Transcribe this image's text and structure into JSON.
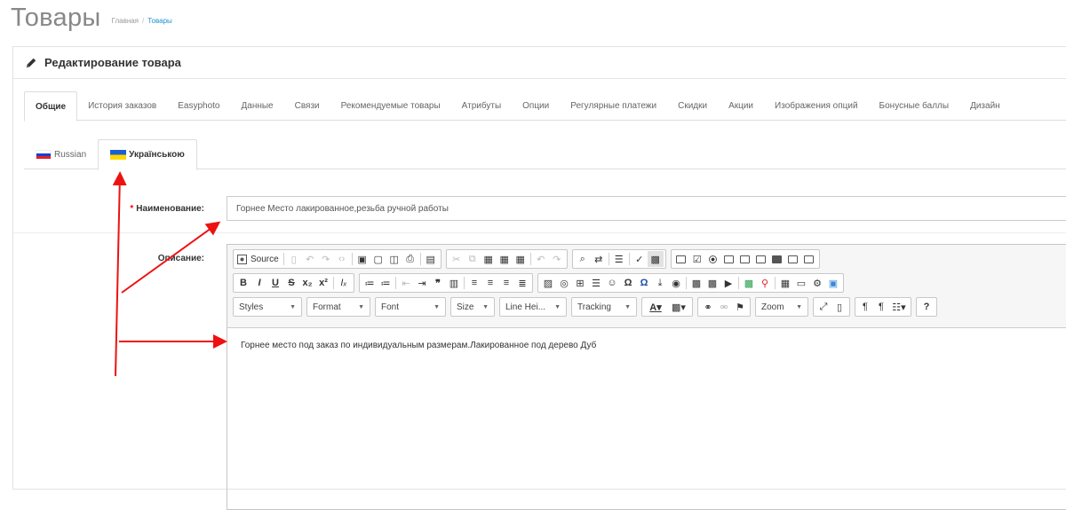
{
  "page": {
    "title": "Товары",
    "breadcrumb": {
      "home": "Главная",
      "separator": "/",
      "current": "Товары"
    }
  },
  "panel": {
    "title": "Редактирование товара",
    "icon": "pencil-icon"
  },
  "tabs": [
    {
      "label": "Общие",
      "active": true
    },
    {
      "label": "История заказов"
    },
    {
      "label": "Easyphoto"
    },
    {
      "label": "Данные"
    },
    {
      "label": "Связи"
    },
    {
      "label": "Рекомендуемые товары"
    },
    {
      "label": "Атрибуты"
    },
    {
      "label": "Опции"
    },
    {
      "label": "Регулярные платежи"
    },
    {
      "label": "Скидки"
    },
    {
      "label": "Акции"
    },
    {
      "label": "Изображения опций"
    },
    {
      "label": "Бонусные баллы"
    },
    {
      "label": "Дизайн"
    }
  ],
  "languages": [
    {
      "label": "Russian",
      "flag": "flag-ru"
    },
    {
      "label": "Українською",
      "flag": "flag-ua",
      "active": true
    }
  ],
  "form": {
    "name_required_mark": "*",
    "name_label": "Наименование:",
    "name_value": "Горнее Место лакированное,резьба ручной работы",
    "description_label": "Описание:"
  },
  "editor": {
    "source_label": "Source",
    "combos": [
      "Styles",
      "Format",
      "Font",
      "Size",
      "Line Hei...",
      "Tracking",
      "Zoom"
    ],
    "content": "Горнее место под заказ по индивидуальным размерам.Лакированное под дерево Дуб",
    "help_label": "?"
  },
  "colors": {
    "accent": "#1e91cf",
    "annotation_arrow": "#ee1111",
    "required": "#ff0000"
  }
}
